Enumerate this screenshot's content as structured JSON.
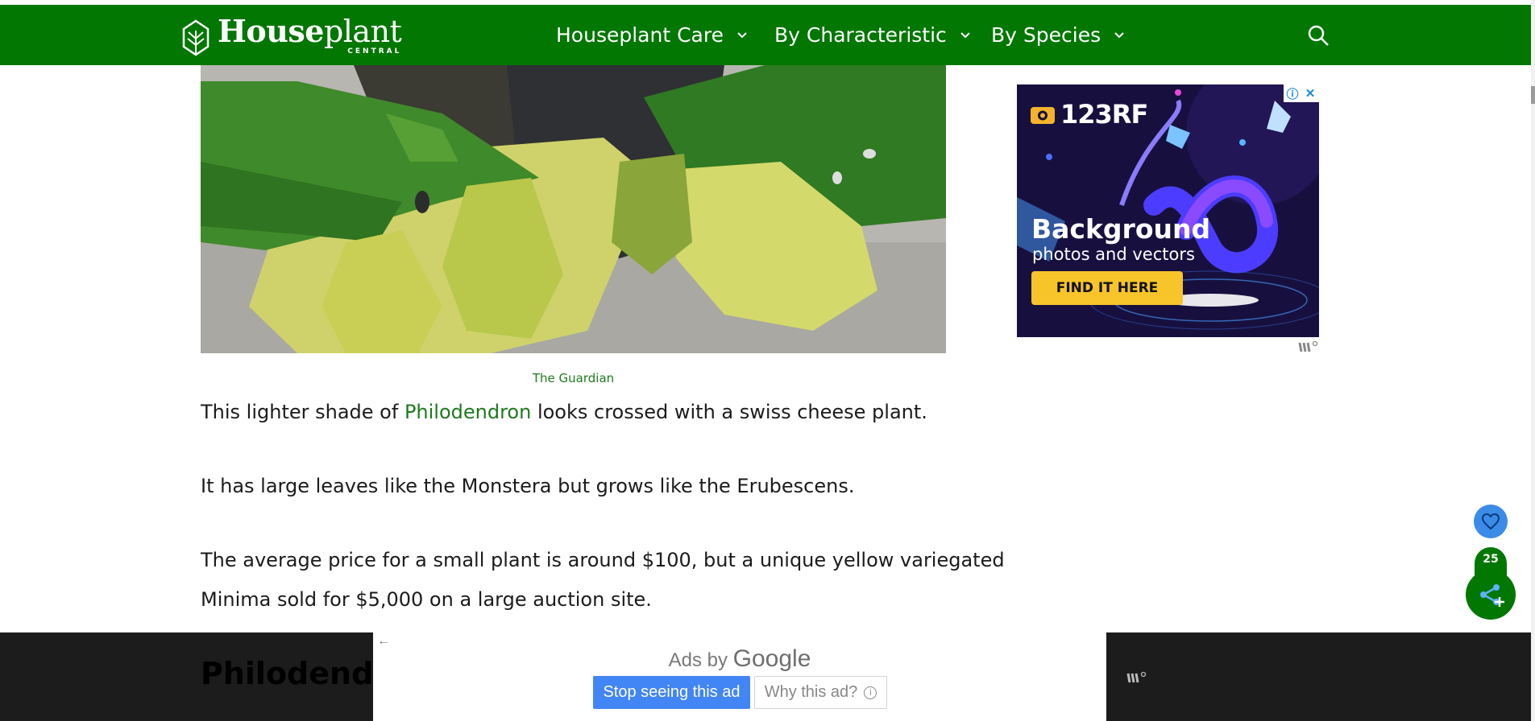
{
  "header": {
    "logo": {
      "main_bold": "House",
      "main_rest": "plant",
      "sub": "CENTRAL"
    },
    "nav": [
      {
        "label": "Houseplant Care"
      },
      {
        "label": "By Characteristic"
      },
      {
        "label": "By Species"
      }
    ],
    "search_icon": "search-icon",
    "background_color": "#027702"
  },
  "article": {
    "image_credit": "The Guardian",
    "paragraph_1": {
      "before": "This lighter shade of ",
      "link": "Philodendron",
      "after": " looks crossed with a swiss cheese plant."
    },
    "paragraph_2": "It has large leaves like the Monstera but grows like the Erubescens.",
    "paragraph_3_line1": "The average price for a small plant is around $100, but a unique yellow variegated",
    "paragraph_3_line2": "Minima sold for $5,000 on a large auction site.",
    "next_heading_partial": "Philodendro",
    "link_color": "#1d7a1d"
  },
  "sidebar_ad": {
    "brand": "123RF",
    "headline": "Background",
    "subline": "photos and vectors",
    "cta": "FIND IT HERE",
    "info_icon": "info-icon",
    "close_icon": "close-icon"
  },
  "floating": {
    "favorite_icon": "heart-icon",
    "share_count": "25",
    "share_icon": "share-icon"
  },
  "bottom_ad": {
    "ads_by": "Ads by",
    "google": "Google",
    "stop_label": "Stop seeing this ad",
    "why_label": "Why this ad?",
    "back_icon": "back-arrow-icon"
  }
}
